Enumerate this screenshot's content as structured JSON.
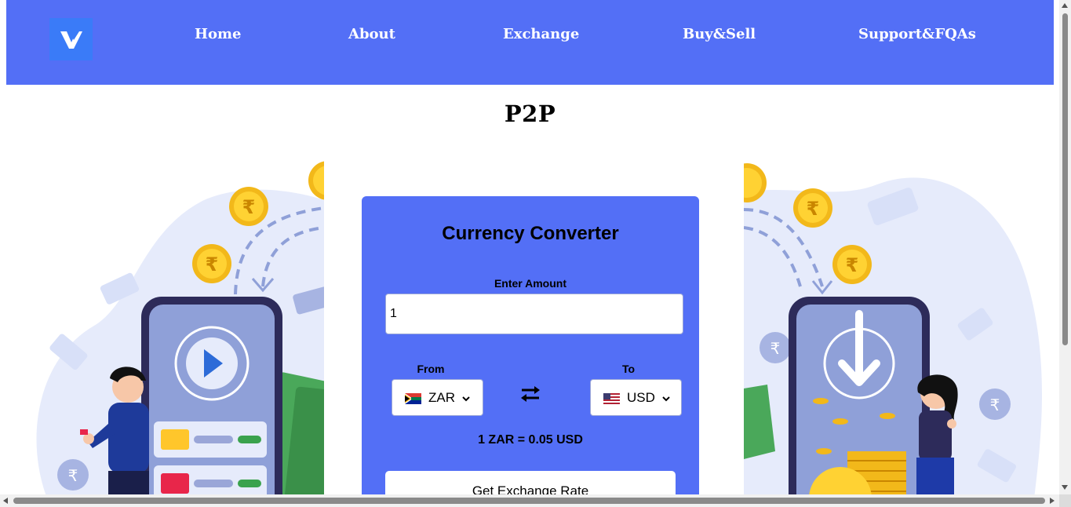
{
  "nav": {
    "items": [
      "Home",
      "About",
      "Exchange",
      "Buy&Sell",
      "Support&FQAs"
    ]
  },
  "page_title": "P2P",
  "converter": {
    "title": "Currency Converter",
    "amount_label": "Enter Amount",
    "amount_value": "1",
    "from_label": "From",
    "to_label": "To",
    "from_currency": "ZAR",
    "to_currency": "USD",
    "rate_text": "1 ZAR = 0.05 USD",
    "button_label": "Get Exchange Rate"
  },
  "colors": {
    "nav_bg": "#536ff6",
    "card_bg": "#536ff6",
    "logo_bg": "#3a7bf8"
  },
  "icons": {
    "logo": "brand-logo-icon",
    "swap": "swap-arrows-icon",
    "chevron": "chevron-down-icon"
  }
}
